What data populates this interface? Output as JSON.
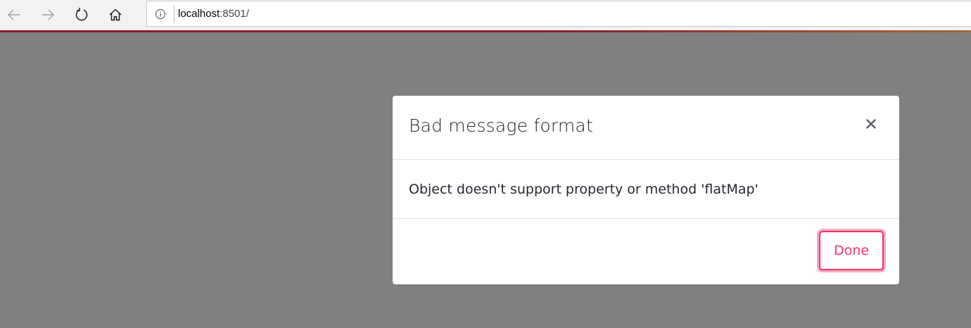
{
  "browser": {
    "back_icon": "back-arrow-icon",
    "forward_icon": "forward-arrow-icon",
    "refresh_icon": "refresh-icon",
    "home_icon": "home-icon",
    "info_icon": "info-icon",
    "url_host": "localhost",
    "url_rest": ":8501/",
    "accent_color": "#8b1a2b"
  },
  "modal": {
    "title": "Bad message format",
    "close_icon": "close-icon",
    "message": "Object doesn't support property or method 'flatMap'",
    "done_label": "Done",
    "accent_color": "#f0356b"
  }
}
